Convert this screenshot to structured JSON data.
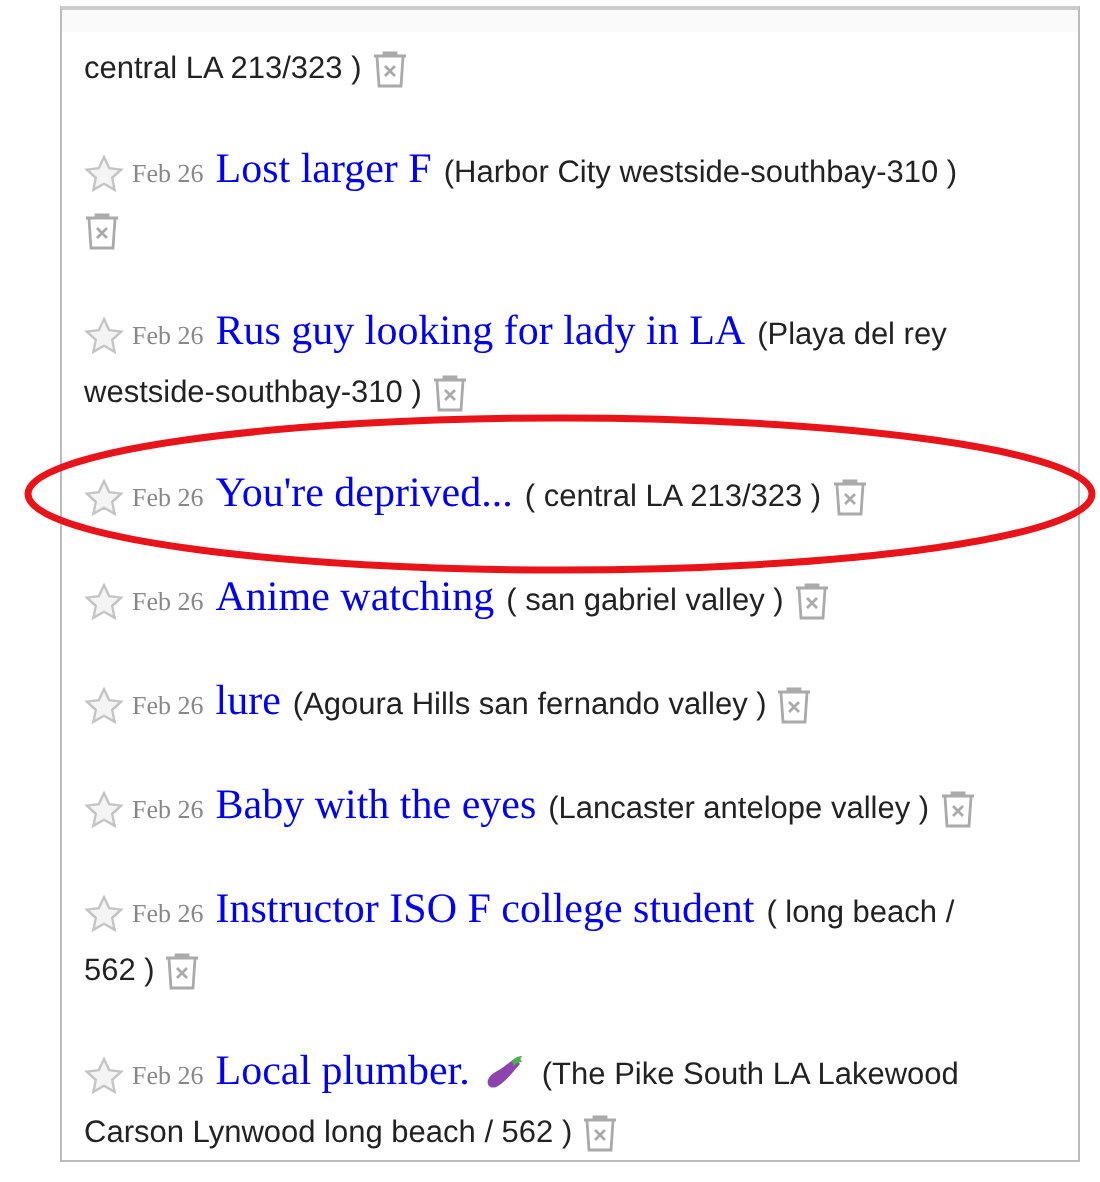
{
  "listings": [
    {
      "kind": "partial",
      "location": [
        "central LA 213/323 )"
      ],
      "circled": false
    },
    {
      "kind": "full",
      "date": "Feb 26",
      "title": "Lost larger F",
      "eggplant": false,
      "location": [
        "(Harbor City westside-southbay-310 )"
      ],
      "circled": false
    },
    {
      "kind": "full",
      "date": "Feb 26",
      "title": "Rus guy looking for lady in LA",
      "eggplant": false,
      "location": [
        "(Playa del rey",
        "westside-southbay-310 )"
      ],
      "circled": false
    },
    {
      "kind": "full",
      "date": "Feb 26",
      "title": "You're deprived...",
      "eggplant": false,
      "location": [
        "( central LA 213/323 )"
      ],
      "circled": true
    },
    {
      "kind": "full",
      "date": "Feb 26",
      "title": "Anime watching",
      "eggplant": false,
      "location": [
        "( san gabriel valley )"
      ],
      "circled": false
    },
    {
      "kind": "full",
      "date": "Feb 26",
      "title": "lure",
      "eggplant": false,
      "location": [
        "(Agoura Hills san fernando valley )"
      ],
      "circled": false
    },
    {
      "kind": "full",
      "date": "Feb 26",
      "title": "Baby with the eyes",
      "eggplant": false,
      "location": [
        "(Lancaster antelope valley )"
      ],
      "circled": false
    },
    {
      "kind": "full",
      "date": "Feb 26",
      "title": "Instructor ISO F college student",
      "eggplant": false,
      "location": [
        "( long beach /",
        "562 )"
      ],
      "circled": false
    },
    {
      "kind": "full",
      "date": "Feb 26",
      "title": "Local plumber.",
      "eggplant": true,
      "location": [
        "(The Pike South LA Lakewood",
        "Carson Lynwood long beach / 562 )"
      ],
      "circled": false
    }
  ]
}
